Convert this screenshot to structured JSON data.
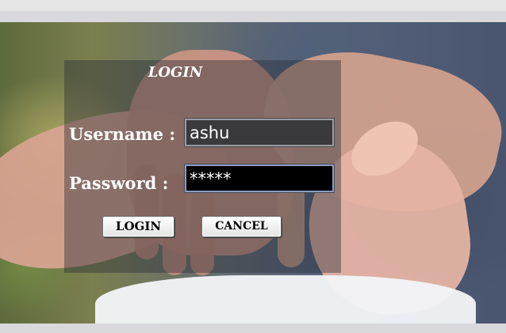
{
  "login_form": {
    "title": "LOGIN",
    "username_label": "Username :",
    "username_value": "ashu",
    "password_label": "Password :",
    "password_value": "*****",
    "login_button": "LOGIN",
    "cancel_button": "CANCEL"
  },
  "colors": {
    "username_field_bg": "#3a3a3c",
    "password_field_bg": "#000000",
    "label_text": "#ffffff"
  }
}
